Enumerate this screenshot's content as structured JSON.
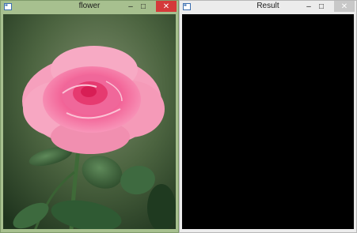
{
  "windows": [
    {
      "title": "flower",
      "controls": {
        "minimize": "–",
        "maximize": "□",
        "close": "✕"
      },
      "content": "rose-photo"
    },
    {
      "title": "Result",
      "controls": {
        "minimize": "–",
        "maximize": "□",
        "close": "✕"
      },
      "content": "black-image"
    }
  ],
  "colors": {
    "left_frame": "#a7c08f",
    "right_frame": "#ececec",
    "close_active": "#d43a3a",
    "result_canvas": "#000000"
  }
}
